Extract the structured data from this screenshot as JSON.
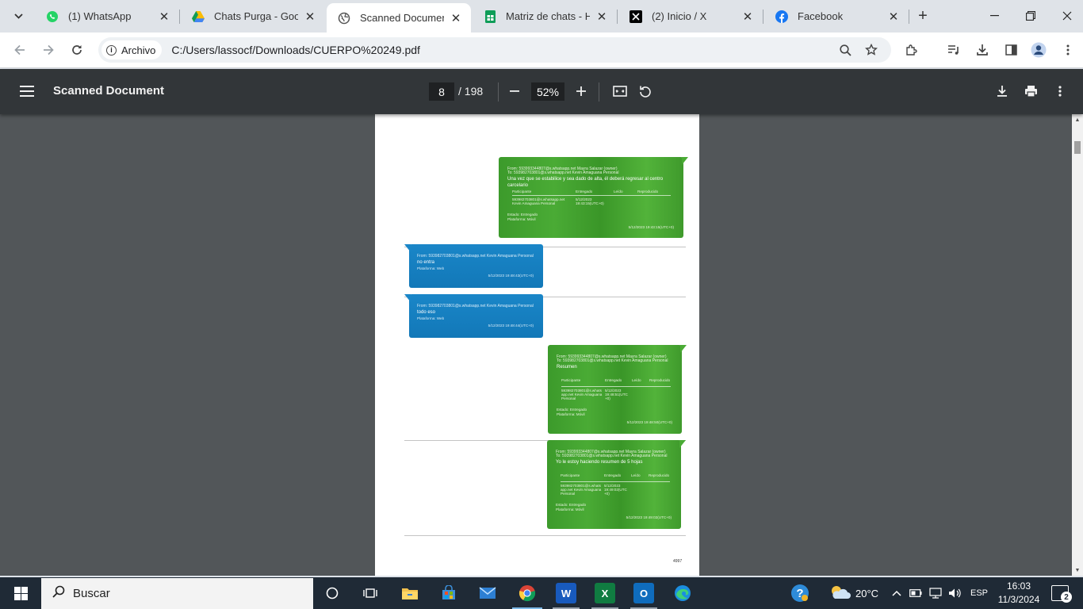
{
  "browser": {
    "tabs": [
      {
        "title": "(1) WhatsApp",
        "icon": "whatsapp-icon",
        "active": false
      },
      {
        "title": "Chats Purga - Google",
        "icon": "google-drive-icon",
        "active": false
      },
      {
        "title": "Scanned Document",
        "icon": "globe-icon",
        "active": true
      },
      {
        "title": "Matriz de chats - Hoj",
        "icon": "google-sheets-icon",
        "active": false
      },
      {
        "title": "(2) Inicio / X",
        "icon": "x-icon",
        "active": false
      },
      {
        "title": "Facebook",
        "icon": "facebook-icon",
        "active": false
      }
    ],
    "site_chip": "Archivo",
    "url": "C:/Users/lassocf/Downloads/CUERPO%20249.pdf"
  },
  "pdf": {
    "title": "Scanned Document",
    "current_page": "8",
    "total_pages": "/ 198",
    "zoom": "52%"
  },
  "document": {
    "page_number_label": "4997",
    "messages": [
      {
        "side": "right",
        "color": "green",
        "from": "From: 593993344807@s.whatsapp.net Mayra Salazar (owner)",
        "to": "To: 593982703801@s.whatsapp.net Kevin Amaguana Personal",
        "body": "Una vez que se estabilice y sea dado de alta, él deberá regresar al centro carcelario",
        "table_headers": [
          "Participante",
          "Entregado",
          "Leído",
          "Reproducido"
        ],
        "table_row_a": "593982703801@s.whatsapp.net",
        "table_row_b": "Kevin Amaguana Personal",
        "table_date_a": "5/12/2023",
        "table_date_b": "19:43:15(UTC+0)",
        "status": "Estado: Entregado",
        "platform": "Plataforma: Móvil",
        "time": "5/12/2023 19:43:15(UTC+0)"
      },
      {
        "side": "left",
        "color": "blue",
        "from": "From: 593982703801@s.whatsapp.net Kevin Amaguana Personal",
        "body": "no entra",
        "platform": "Plataforma: Web",
        "time": "5/12/2023 19:48:43(UTC+0)"
      },
      {
        "side": "left",
        "color": "blue",
        "from": "From: 593982703801@s.whatsapp.net Kevin Amaguana Personal",
        "body": "todo eso",
        "platform": "Plataforma: Web",
        "time": "5/12/2023 19:48:44(UTC+0)"
      },
      {
        "side": "right",
        "color": "green",
        "from": "From: 593993344807@s.whatsapp.net Mayra Salazar (owner)",
        "to": "To: 593982703801@s.whatsapp.net Kevin Amaguana Personal",
        "body": "Resumen",
        "table_headers": [
          "Participante",
          "Entregado",
          "Leído",
          "Reproducido"
        ],
        "table_row_a": "593982703801@s.whats",
        "table_row_b": "app.net Kevin Amaguana",
        "table_row_c": "Personal",
        "table_date_a": "5/12/2023",
        "table_date_b": "19:48:51(UTC",
        "table_date_c": "+0)",
        "status": "Estado: Entregado",
        "platform": "Plataforma: Móvil",
        "time": "5/12/2023 19:48:50(UTC+0)"
      },
      {
        "side": "right",
        "color": "green",
        "from": "From: 593993344807@s.whatsapp.net Mayra Salazar (owner)",
        "to": "To: 593982703801@s.whatsapp.net Kevin Amaguana Personal",
        "body": "Yo le estoy haciendo resumen de 5 hojas",
        "table_headers": [
          "Participante",
          "Entregado",
          "Leído",
          "Reproducido"
        ],
        "table_row_a": "593982703801@s.whats",
        "table_row_b": "app.net Kevin Amaguana",
        "table_row_c": "Personal",
        "table_date_a": "5/12/2023",
        "table_date_b": "19:49:02(UTC",
        "table_date_c": "+0)",
        "status": "Estado: Entregado",
        "platform": "Plataforma: Móvil",
        "time": "5/12/2023 19:49:02(UTC+0)"
      }
    ]
  },
  "taskbar": {
    "search_placeholder": "Buscar",
    "weather": "20°C",
    "language": "ESP",
    "time": "16:03",
    "date": "11/3/2024",
    "notification_count": "2"
  },
  "colors": {
    "pdf_toolbar": "#323639",
    "doc_background": "#525659",
    "whatsapp_green": "#4aab35",
    "whatsapp_blue": "#1a86c8",
    "taskbar": "#1f2a36"
  }
}
